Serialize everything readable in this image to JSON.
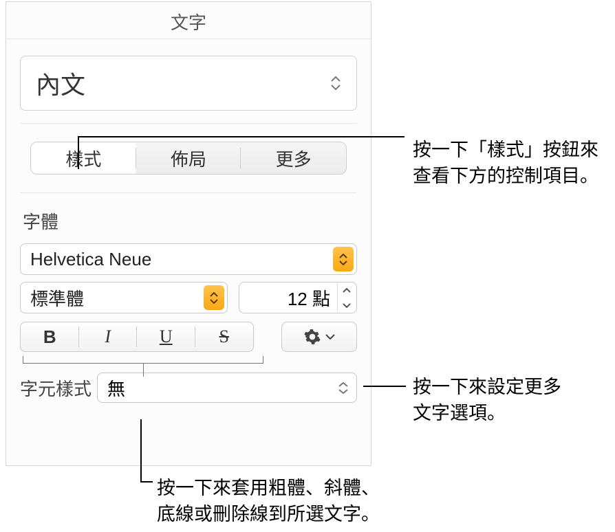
{
  "panel": {
    "title": "文字",
    "paragraph_style": "內文",
    "tabs": {
      "style": "樣式",
      "layout": "佈局",
      "more": "更多"
    },
    "font_section_label": "字體",
    "font_family": "Helvetica Neue",
    "font_weight": "標準體",
    "font_size": "12 點",
    "char_style_label": "字元樣式",
    "char_style_value": "無"
  },
  "callouts": {
    "tabs_hint_l1": "按一下「樣式」按鈕來",
    "tabs_hint_l2": "查看下方的控制項目。",
    "gear_hint_l1": "按一下來設定更多",
    "gear_hint_l2": "文字選項。",
    "bius_hint_l1": "按一下來套用粗體、斜體、",
    "bius_hint_l2": "底線或刪除線到所選文字。"
  }
}
